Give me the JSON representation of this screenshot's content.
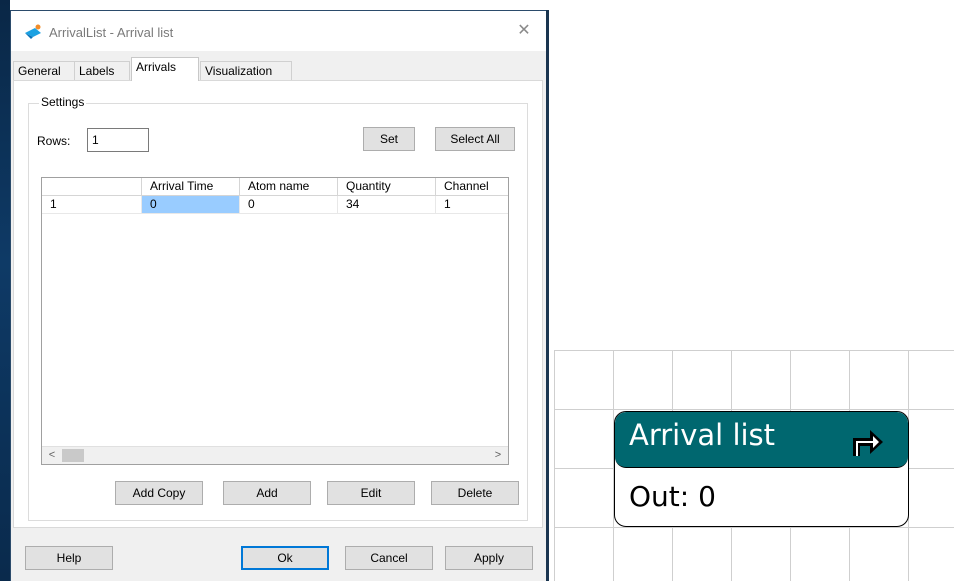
{
  "window": {
    "title": "ArrivalList - Arrival list",
    "close_glyph": "✕"
  },
  "tabs": [
    {
      "label": "General"
    },
    {
      "label": "Labels"
    },
    {
      "label": "Arrivals",
      "active": true
    },
    {
      "label": "Visualization"
    }
  ],
  "settings": {
    "group_label": "Settings",
    "rows_label": "Rows:",
    "rows_value": "1",
    "set_label": "Set",
    "select_all_label": "Select All"
  },
  "table": {
    "columns": [
      "",
      "Arrival Time",
      "Atom name",
      "Quantity",
      "Channel"
    ],
    "rows": [
      [
        "1",
        "0",
        "0",
        "34",
        "1"
      ]
    ],
    "selected_cell": {
      "row": 0,
      "col": 1
    }
  },
  "scrollbar": {
    "left_glyph": "<",
    "right_glyph": ">"
  },
  "actions": {
    "add_copy_label": "Add Copy",
    "add_label": "Add",
    "edit_label": "Edit",
    "delete_label": "Delete"
  },
  "footer": {
    "help_label": "Help",
    "ok_label": "Ok",
    "cancel_label": "Cancel",
    "apply_label": "Apply"
  },
  "node": {
    "title": "Arrival list",
    "out_text": "Out: 0",
    "icon": "turn-right-arrow-icon",
    "header_color": "#00676f"
  },
  "colors": {
    "selection": "#99ccff",
    "default_button_border": "#0078d7",
    "app_icon_blue": "#1ba1e2"
  }
}
